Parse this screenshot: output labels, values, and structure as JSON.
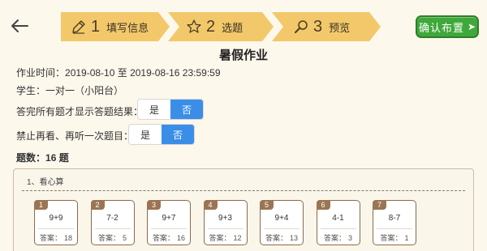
{
  "steps": [
    {
      "num": "1",
      "label": "填写信息",
      "icon": "pencil-icon"
    },
    {
      "num": "2",
      "label": "选题",
      "icon": "star-icon"
    },
    {
      "num": "3",
      "label": "预览",
      "icon": "magnifier-icon"
    }
  ],
  "header": {
    "confirm_label": "确认布置",
    "confirm_arrow": "➤"
  },
  "page_title": "暑假作业",
  "info": {
    "time_label": "作业时间：",
    "time_value": "2019-08-10 至 2019-08-16 23:59:59",
    "student_label": "学生：",
    "student_value": "一对一（小阳台）",
    "q1_label": "答完所有题才显示答题结果：",
    "q2_label": "禁止再看、再听一次题目：",
    "count_label": "题数：",
    "count_value": "16 题"
  },
  "toggle1": {
    "yes": "是",
    "no": "否",
    "selected": "否"
  },
  "toggle2": {
    "yes": "是",
    "no": "否",
    "selected": "否"
  },
  "section": {
    "title": "1、看心算",
    "answer_label": "答案：",
    "cards": [
      {
        "no": "1",
        "expr": "9+9",
        "answer": "18"
      },
      {
        "no": "2",
        "expr": "7-2",
        "answer": "5"
      },
      {
        "no": "3",
        "expr": "9+7",
        "answer": "16"
      },
      {
        "no": "4",
        "expr": "9+3",
        "answer": "12"
      },
      {
        "no": "5",
        "expr": "9+4",
        "answer": "13"
      },
      {
        "no": "6",
        "expr": "4-1",
        "answer": "3"
      },
      {
        "no": "7",
        "expr": "8-7",
        "answer": "1"
      }
    ]
  },
  "colors": {
    "step_fill": "#f2c86a",
    "accent_blue": "#3b8ee8",
    "confirm_green": "#3fa83a",
    "card_brown": "#9b7553"
  }
}
